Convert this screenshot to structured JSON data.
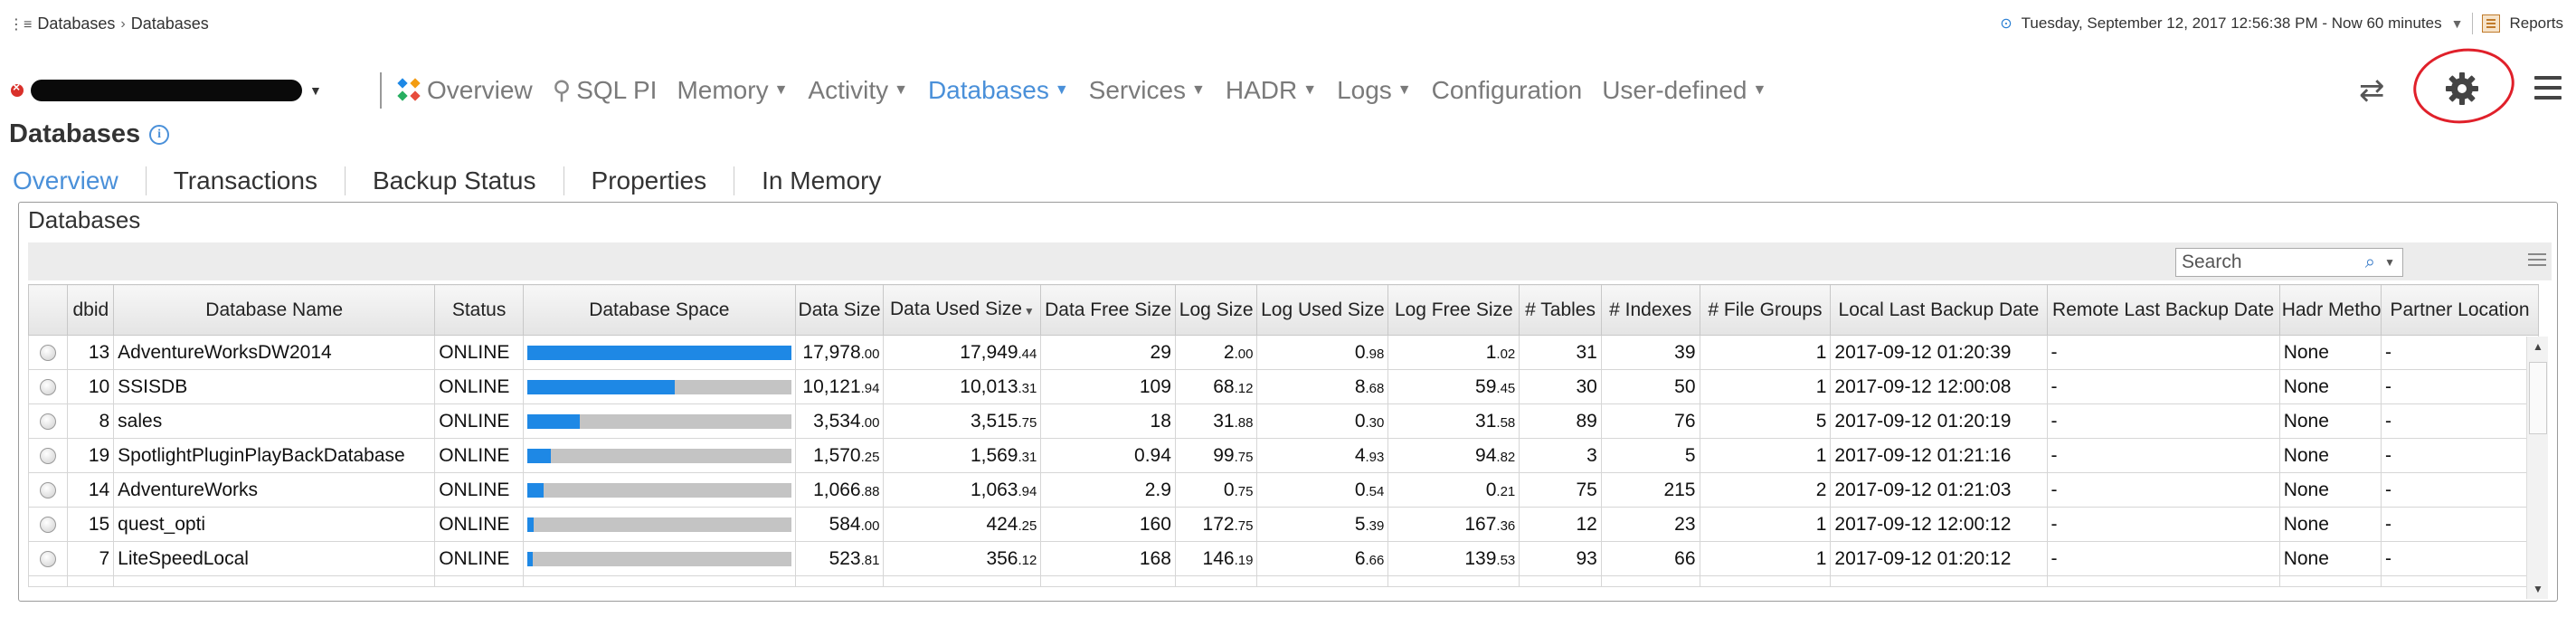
{
  "breadcrumb": {
    "root": "Databases",
    "current": "Databases"
  },
  "top_right": {
    "timestamp": "Tuesday, September 12, 2017 12:56:38 PM - Now 60 minutes",
    "reports": "Reports"
  },
  "nav": {
    "tabs": [
      {
        "label": "Overview",
        "icon": "overview-icon",
        "dropdown": false,
        "active": false
      },
      {
        "label": "SQL PI",
        "icon": "sql-pi-icon",
        "dropdown": false,
        "active": false
      },
      {
        "label": "Memory",
        "dropdown": true,
        "active": false
      },
      {
        "label": "Activity",
        "dropdown": true,
        "active": false
      },
      {
        "label": "Databases",
        "dropdown": true,
        "active": true
      },
      {
        "label": "Services",
        "dropdown": true,
        "active": false
      },
      {
        "label": "HADR",
        "dropdown": true,
        "active": false
      },
      {
        "label": "Logs",
        "dropdown": true,
        "active": false
      },
      {
        "label": "Configuration",
        "dropdown": false,
        "active": false
      },
      {
        "label": "User-defined",
        "dropdown": true,
        "active": false
      }
    ],
    "icons": {
      "refresh": "refresh-icon",
      "settings": "gear-icon",
      "menu": "hamburger-menu-icon"
    },
    "accent": "#4a90d9"
  },
  "page_title": "Databases",
  "subtabs": [
    "Overview",
    "Transactions",
    "Backup Status",
    "Properties",
    "In Memory"
  ],
  "panel": {
    "title": "Databases",
    "search_placeholder": "Search"
  },
  "table": {
    "headers": [
      "",
      "dbid",
      "Database Name",
      "Status",
      "Database Space",
      "Data Size",
      "Data Used Size",
      "Data Free Size",
      "Log Size",
      "Log Used Size",
      "Log Free Size",
      "# Tables",
      "# Indexes",
      "# File Groups",
      "Local Last Backup Date",
      "Remote Last Backup Date",
      "Hadr Method",
      "Partner Location"
    ],
    "sorted_column": "Data Used Size",
    "rows": [
      {
        "dbid": "13",
        "name": "AdventureWorksDW2014",
        "status": "ONLINE",
        "space": 1.0,
        "data_size": [
          "17,978",
          ".00"
        ],
        "data_used": [
          "17,949",
          ".44"
        ],
        "data_free": [
          "29",
          ""
        ],
        "log_size": [
          "2",
          ".00"
        ],
        "log_used": [
          "0",
          ".98"
        ],
        "log_free": [
          "1",
          ".02"
        ],
        "tables": "31",
        "indexes": "39",
        "filegroups": "1",
        "local_backup": "2017-09-12 01:20:39",
        "remote_backup": "-",
        "hadr": "None",
        "partner": "-"
      },
      {
        "dbid": "10",
        "name": "SSISDB",
        "status": "ONLINE",
        "space": 0.56,
        "data_size": [
          "10,121",
          ".94"
        ],
        "data_used": [
          "10,013",
          ".31"
        ],
        "data_free": [
          "109",
          ""
        ],
        "log_size": [
          "68",
          ".12"
        ],
        "log_used": [
          "8",
          ".68"
        ],
        "log_free": [
          "59",
          ".45"
        ],
        "tables": "30",
        "indexes": "50",
        "filegroups": "1",
        "local_backup": "2017-09-12 12:00:08",
        "remote_backup": "-",
        "hadr": "None",
        "partner": "-"
      },
      {
        "dbid": "8",
        "name": "sales",
        "status": "ONLINE",
        "space": 0.2,
        "data_size": [
          "3,534",
          ".00"
        ],
        "data_used": [
          "3,515",
          ".75"
        ],
        "data_free": [
          "18",
          ""
        ],
        "log_size": [
          "31",
          ".88"
        ],
        "log_used": [
          "0",
          ".30"
        ],
        "log_free": [
          "31",
          ".58"
        ],
        "tables": "89",
        "indexes": "76",
        "filegroups": "5",
        "local_backup": "2017-09-12 01:20:19",
        "remote_backup": "-",
        "hadr": "None",
        "partner": "-"
      },
      {
        "dbid": "19",
        "name": "SpotlightPluginPlayBackDatabase",
        "status": "ONLINE",
        "space": 0.09,
        "data_size": [
          "1,570",
          ".25"
        ],
        "data_used": [
          "1,569",
          ".31"
        ],
        "data_free": [
          "0.94",
          ""
        ],
        "log_size": [
          "99",
          ".75"
        ],
        "log_used": [
          "4",
          ".93"
        ],
        "log_free": [
          "94",
          ".82"
        ],
        "tables": "3",
        "indexes": "5",
        "filegroups": "1",
        "local_backup": "2017-09-12 01:21:16",
        "remote_backup": "-",
        "hadr": "None",
        "partner": "-"
      },
      {
        "dbid": "14",
        "name": "AdventureWorks",
        "status": "ONLINE",
        "space": 0.06,
        "data_size": [
          "1,066",
          ".88"
        ],
        "data_used": [
          "1,063",
          ".94"
        ],
        "data_free": [
          "2.9",
          ""
        ],
        "log_size": [
          "0",
          ".75"
        ],
        "log_used": [
          "0",
          ".54"
        ],
        "log_free": [
          "0",
          ".21"
        ],
        "tables": "75",
        "indexes": "215",
        "filegroups": "2",
        "local_backup": "2017-09-12 01:21:03",
        "remote_backup": "-",
        "hadr": "None",
        "partner": "-"
      },
      {
        "dbid": "15",
        "name": "quest_opti",
        "status": "ONLINE",
        "space": 0.025,
        "data_size": [
          "584",
          ".00"
        ],
        "data_used": [
          "424",
          ".25"
        ],
        "data_free": [
          "160",
          ""
        ],
        "log_size": [
          "172",
          ".75"
        ],
        "log_used": [
          "5",
          ".39"
        ],
        "log_free": [
          "167",
          ".36"
        ],
        "tables": "12",
        "indexes": "23",
        "filegroups": "1",
        "local_backup": "2017-09-12 12:00:12",
        "remote_backup": "-",
        "hadr": "None",
        "partner": "-"
      },
      {
        "dbid": "7",
        "name": "LiteSpeedLocal",
        "status": "ONLINE",
        "space": 0.02,
        "data_size": [
          "523",
          ".81"
        ],
        "data_used": [
          "356",
          ".12"
        ],
        "data_free": [
          "168",
          ""
        ],
        "log_size": [
          "146",
          ".19"
        ],
        "log_used": [
          "6",
          ".66"
        ],
        "log_free": [
          "139",
          ".53"
        ],
        "tables": "93",
        "indexes": "66",
        "filegroups": "1",
        "local_backup": "2017-09-12 01:20:12",
        "remote_backup": "-",
        "hadr": "None",
        "partner": "-"
      }
    ]
  }
}
